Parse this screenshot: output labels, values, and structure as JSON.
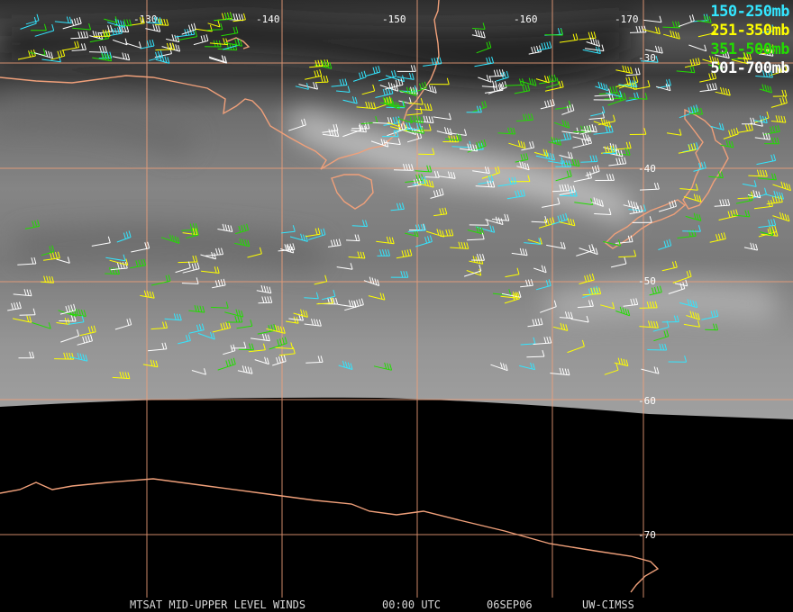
{
  "map": {
    "longitude_labels": [
      "-130",
      "-140",
      "-150",
      "-160",
      "-170"
    ],
    "latitude_labels": [
      "-30",
      "-40",
      "-50",
      "-60",
      "-70"
    ],
    "colors": {
      "grid": "#f0a07a",
      "coast": "#f0a07a",
      "imagery_light": "#8f8f8f",
      "imagery_dark": "#3a3a3a",
      "space": "#000000"
    }
  },
  "legend": [
    {
      "label": "150-250mb",
      "color": "#33e6ff"
    },
    {
      "label": "251-350mb",
      "color": "#ffff00"
    },
    {
      "label": "351-500mb",
      "color": "#22dd00"
    },
    {
      "label": "501-700mb",
      "color": "#ffffff"
    }
  ],
  "footer": {
    "product": "MTSAT MID-UPPER LEVEL WINDS",
    "time": "00:00 UTC",
    "date": "06SEP06",
    "source": "UW-CIMSS"
  }
}
